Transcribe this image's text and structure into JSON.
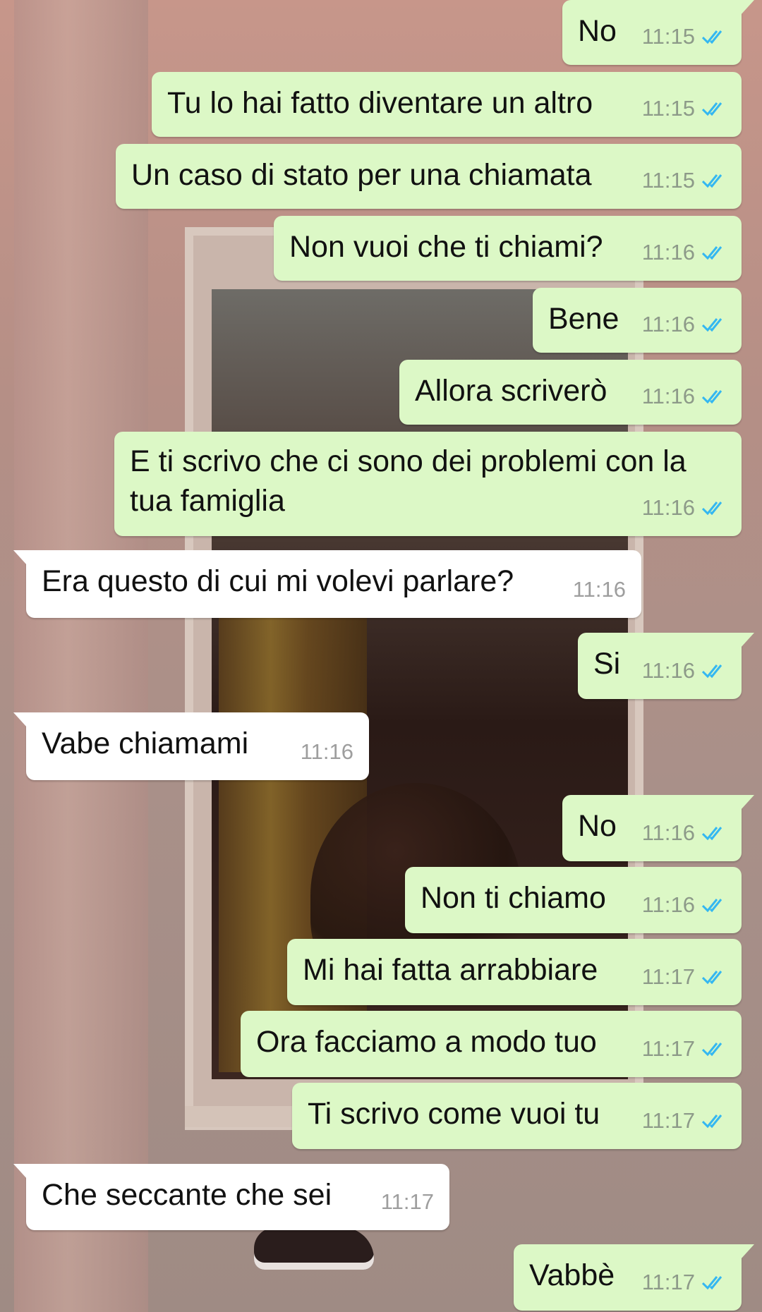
{
  "conversation": {
    "messages": [
      {
        "direction": "out",
        "text": "No",
        "time": "11:15",
        "status": "read"
      },
      {
        "direction": "out",
        "text": "Tu lo hai fatto diventare un altro",
        "time": "11:15",
        "status": "read"
      },
      {
        "direction": "out",
        "text": "Un caso di stato per una chiamata",
        "time": "11:15",
        "status": "read"
      },
      {
        "direction": "out",
        "text": "Non vuoi che ti chiami?",
        "time": "11:16",
        "status": "read"
      },
      {
        "direction": "out",
        "text": "Bene",
        "time": "11:16",
        "status": "read"
      },
      {
        "direction": "out",
        "text": "Allora scriverò",
        "time": "11:16",
        "status": "read"
      },
      {
        "direction": "out",
        "text": "E ti scrivo che ci sono dei problemi con la tua famiglia",
        "time": "11:16",
        "status": "read"
      },
      {
        "direction": "in",
        "text": "Era questo di cui mi volevi parlare?",
        "time": "11:16"
      },
      {
        "direction": "out",
        "text": "Si",
        "time": "11:16",
        "status": "read"
      },
      {
        "direction": "in",
        "text": "Vabe chiamami",
        "time": "11:16"
      },
      {
        "direction": "out",
        "text": "No",
        "time": "11:16",
        "status": "read"
      },
      {
        "direction": "out",
        "text": "Non ti chiamo",
        "time": "11:16",
        "status": "read"
      },
      {
        "direction": "out",
        "text": "Mi hai fatta arrabbiare",
        "time": "11:17",
        "status": "read"
      },
      {
        "direction": "out",
        "text": "Ora facciamo a modo tuo",
        "time": "11:17",
        "status": "read"
      },
      {
        "direction": "out",
        "text": "Ti scrivo come vuoi tu",
        "time": "11:17",
        "status": "read"
      },
      {
        "direction": "in",
        "text": "Che seccante che sei",
        "time": "11:17"
      },
      {
        "direction": "out",
        "text": "Vabbè",
        "time": "11:17",
        "status": "read"
      }
    ]
  },
  "colors": {
    "outgoing_bubble": "#dcf8c6",
    "incoming_bubble": "#ffffff",
    "read_ticks": "#34b7f1",
    "timestamp": "#8d9a89"
  },
  "icons": {
    "read_status": "double-check-icon"
  }
}
